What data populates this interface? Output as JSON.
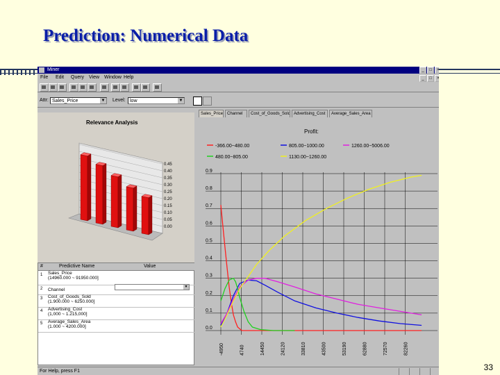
{
  "slide": {
    "title": "Prediction: Numerical Data",
    "page_number": "33"
  },
  "window": {
    "title": "Miner",
    "buttons": [
      "_",
      "□",
      "×"
    ],
    "doc_buttons": [
      "_",
      "□",
      "×"
    ]
  },
  "menu": [
    "File",
    "Edit",
    "Query",
    "View",
    "Window",
    "Help"
  ],
  "filters": {
    "attr_label": "Attr:",
    "attr_value": "Sales_Price",
    "level_label": "Level:",
    "level_value": "low"
  },
  "tabs": [
    "Sales_Price",
    "Channel",
    "Cost_of_Goods_Sold",
    "Advertising_Cost",
    "Average_Sales_Area"
  ],
  "relevance": {
    "title": "Relevance Analysis",
    "axis_labels": [
      "0.45",
      "0.40",
      "0.35",
      "0.30",
      "0.25",
      "0.20",
      "0.15",
      "0.10",
      "0.05",
      "0.00"
    ],
    "values": [
      0.42,
      0.38,
      0.33,
      0.28,
      0.24
    ]
  },
  "grid": {
    "headers": [
      "#",
      "Predictive Name",
      "Value"
    ],
    "rows": [
      {
        "num": "1",
        "name": "Sales_Price\n(14960.000 ~ 91950.000]"
      },
      {
        "num": "2",
        "name": "Channel"
      },
      {
        "num": "3",
        "name": "Cost_of_Goods_Sold\n(1.900.000 ~ 6250.000]"
      },
      {
        "num": "4",
        "name": "Advertising_Cost\n(1,000 ~ 1.215,000]"
      },
      {
        "num": "5",
        "name": "Average_Sales_Area\n(1.000 ~ 4200.000]"
      }
    ]
  },
  "status": {
    "text": "For Help, press F1"
  },
  "chart_data": {
    "type": "line",
    "title": "Profit:",
    "xlabel": "",
    "ylabel": "",
    "x_ticks": [
      "-4950",
      "4740",
      "14450",
      "24120",
      "33810",
      "43500",
      "53190",
      "62880",
      "72570",
      "82260"
    ],
    "y_ticks": [
      "0.9",
      "0.8",
      "0.7",
      "0.6",
      "0.5",
      "0.4",
      "0.3",
      "0.2",
      "0.1",
      "0.0"
    ],
    "ylim": [
      0,
      0.9
    ],
    "xlim": [
      -4950,
      90000
    ],
    "grid": true,
    "legend_position": "top",
    "series": [
      {
        "name": "-366.00~480.00",
        "color": "#ff2020",
        "x": [
          -4950,
          -4000,
          -3000,
          -2000,
          -1000,
          0,
          1000,
          2000,
          3000,
          4000,
          5000,
          6000,
          8000,
          90000
        ],
        "y": [
          0.72,
          0.6,
          0.48,
          0.36,
          0.25,
          0.16,
          0.09,
          0.05,
          0.02,
          0.01,
          0.0,
          0.0,
          0.0,
          0.0
        ]
      },
      {
        "name": "805.00~1000.00",
        "color": "#1010e0",
        "x": [
          -4950,
          -2000,
          1000,
          4000,
          8000,
          12000,
          16000,
          22000,
          30000,
          40000,
          50000,
          60000,
          70000,
          80000,
          90000
        ],
        "y": [
          0.03,
          0.1,
          0.2,
          0.27,
          0.29,
          0.285,
          0.26,
          0.22,
          0.17,
          0.13,
          0.1,
          0.075,
          0.055,
          0.04,
          0.03
        ]
      },
      {
        "name": "1260.00~5006.00",
        "color": "#e020e0",
        "x": [
          -4950,
          -2000,
          1000,
          4000,
          8000,
          12000,
          16000,
          22000,
          30000,
          40000,
          50000,
          60000,
          70000,
          80000,
          90000
        ],
        "y": [
          0.04,
          0.1,
          0.18,
          0.25,
          0.29,
          0.3,
          0.3,
          0.28,
          0.25,
          0.21,
          0.18,
          0.15,
          0.13,
          0.11,
          0.09
        ]
      },
      {
        "name": "480.00~805.00",
        "color": "#20d020",
        "x": [
          -4950,
          -3000,
          -1000,
          1000,
          2000,
          3000,
          4000,
          6000,
          8000,
          10000,
          14000,
          20000,
          30000
        ],
        "y": [
          0.17,
          0.24,
          0.29,
          0.3,
          0.28,
          0.24,
          0.19,
          0.11,
          0.05,
          0.02,
          0.005,
          0.0,
          0.0
        ]
      },
      {
        "name": "1130.00~1260.00",
        "color": "#f0f020",
        "x": [
          -4950,
          -2000,
          1000,
          4000,
          8000,
          12000,
          18000,
          25000,
          35000,
          45000,
          55000,
          65000,
          75000,
          85000,
          90000
        ],
        "y": [
          0.02,
          0.09,
          0.17,
          0.24,
          0.31,
          0.38,
          0.46,
          0.54,
          0.63,
          0.7,
          0.76,
          0.81,
          0.85,
          0.88,
          0.89
        ]
      }
    ]
  }
}
